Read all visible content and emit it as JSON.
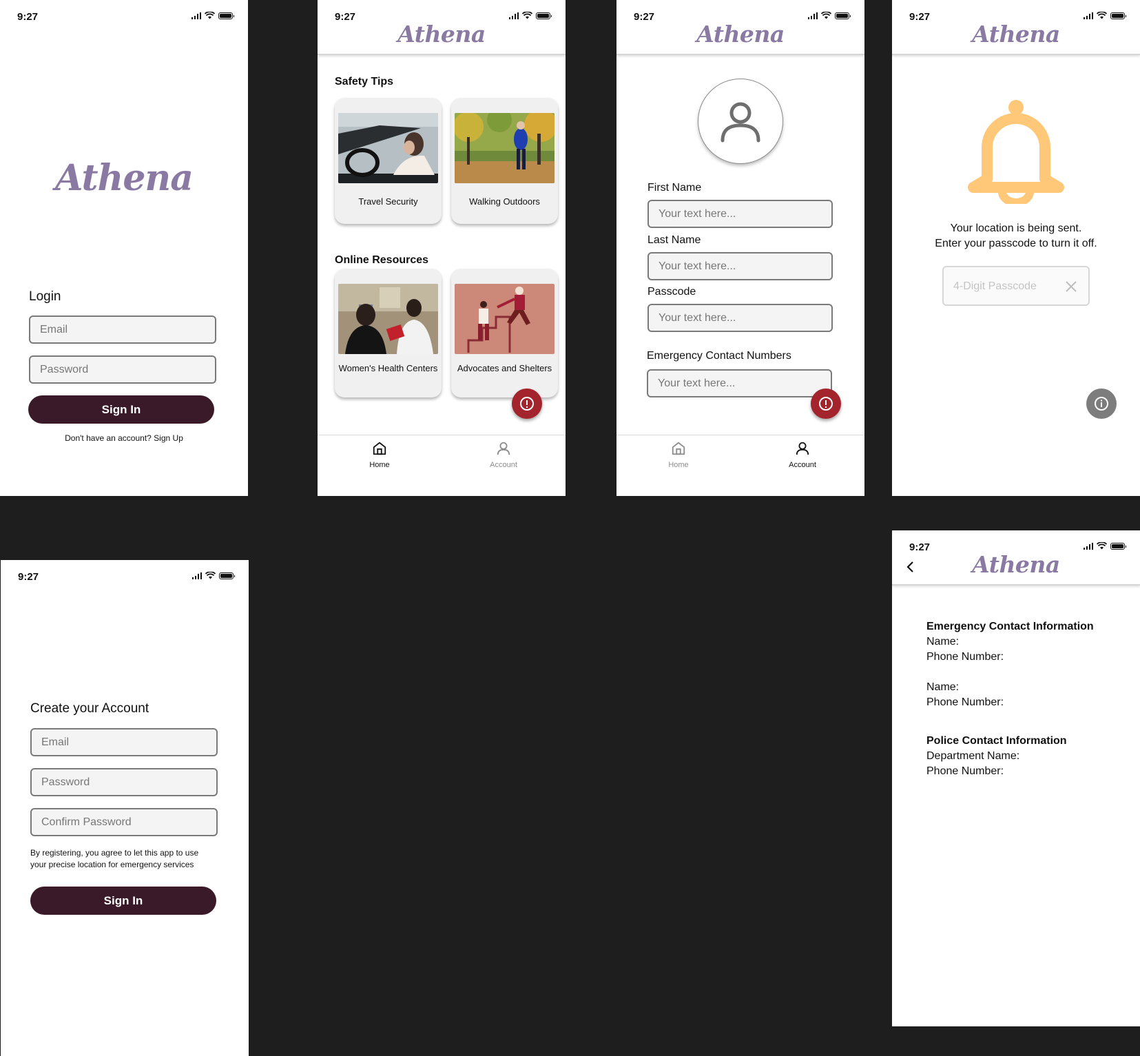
{
  "status": {
    "time": "9:27"
  },
  "brand": "Athena",
  "login": {
    "heading": "Login",
    "email_placeholder": "Email",
    "password_placeholder": "Password",
    "sign_in": "Sign In",
    "signup_prompt": "Don't have an account? Sign Up"
  },
  "home": {
    "safety_title": "Safety Tips",
    "safety_cards": [
      {
        "caption": "Travel Security"
      },
      {
        "caption": "Walking Outdoors"
      }
    ],
    "resources_title": "Online Resources",
    "resource_cards": [
      {
        "caption": "Women's Health Centers"
      },
      {
        "caption": "Advocates and Shelters"
      }
    ]
  },
  "tabs": {
    "home": "Home",
    "account": "Account"
  },
  "account": {
    "first_name_label": "First Name",
    "last_name_label": "Last Name",
    "passcode_label": "Passcode",
    "emergency_label": "Emergency Contact Numbers",
    "placeholder": "Your text here..."
  },
  "alert": {
    "line1": "Your location is being sent.",
    "line2": "Enter your passcode to turn it off.",
    "passcode_placeholder": "4-Digit Passcode",
    "bell_color": "#ffc878"
  },
  "register": {
    "heading": "Create your Account",
    "email_placeholder": "Email",
    "password_placeholder": "Password",
    "confirm_placeholder": "Confirm Password",
    "consent_line1": "By registering, you agree to let this app to use",
    "consent_line2": "your precise location for emergency services",
    "sign_in": "Sign In"
  },
  "contacts": {
    "emergency_title": "Emergency Contact Information",
    "name_label": "Name:",
    "phone_label": "Phone Number:",
    "police_title": "Police Contact Information",
    "department_label": "Department Name:"
  },
  "colors": {
    "brand": "#8a7aa3",
    "primary_button": "#3a1a28",
    "sos": "#a3242c",
    "background": "#1e1e1e"
  }
}
